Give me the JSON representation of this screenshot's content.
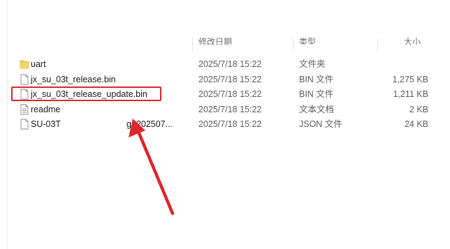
{
  "header": {
    "name_label": "",
    "date_label": "修改日期",
    "type_label": "类型",
    "size_label": "大小"
  },
  "files": [
    {
      "name": "uart",
      "date": "2025/7/18 15:22",
      "type": "文件夹",
      "size": "",
      "icon": "folder-icon"
    },
    {
      "name": "jx_su_03t_release.bin",
      "date": "2025/7/18 15:22",
      "type": "BIN 文件",
      "size": "1,275 KB",
      "icon": "file-icon"
    },
    {
      "name": "jx_su_03t_release_update.bin",
      "date": "2025/7/18 15:22",
      "type": "BIN 文件",
      "size": "1,211 KB",
      "icon": "file-icon"
    },
    {
      "name": "readme",
      "date": "2025/7/18 15:22",
      "type": "文本文档",
      "size": "2 KB",
      "icon": "text-file-icon"
    },
    {
      "name": "SU-03T",
      "name_extra": "g_202507...",
      "date": "2025/7/18 15:22",
      "type": "JSON 文件",
      "size": "24 KB",
      "icon": "file-icon"
    }
  ],
  "colors": {
    "highlight": "#e0242b",
    "folder": "#f2c54b"
  }
}
